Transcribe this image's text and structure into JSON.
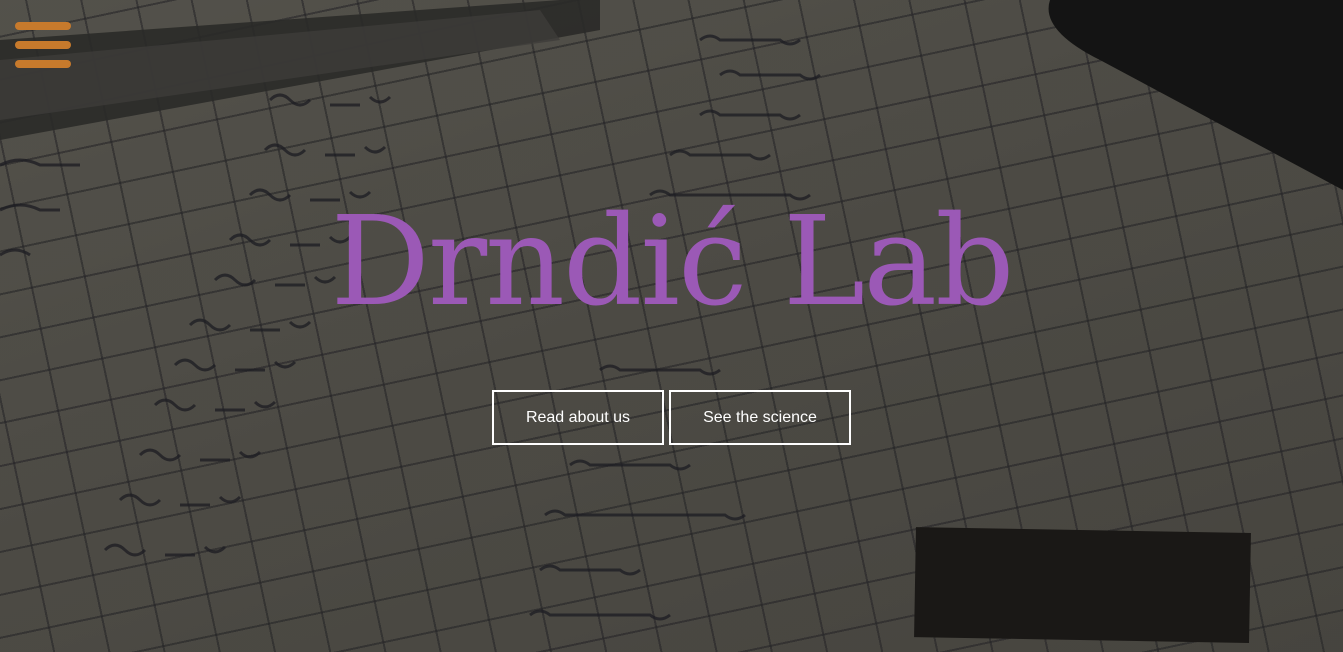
{
  "site": {
    "title": "Drndić Lab"
  },
  "nav": {
    "menu_icon": "hamburger-menu-icon",
    "menu_color": "#c77a2c"
  },
  "hero": {
    "title_color": "#9b59b6",
    "buttons": [
      {
        "label": "Read about us"
      },
      {
        "label": "See the science"
      }
    ]
  }
}
